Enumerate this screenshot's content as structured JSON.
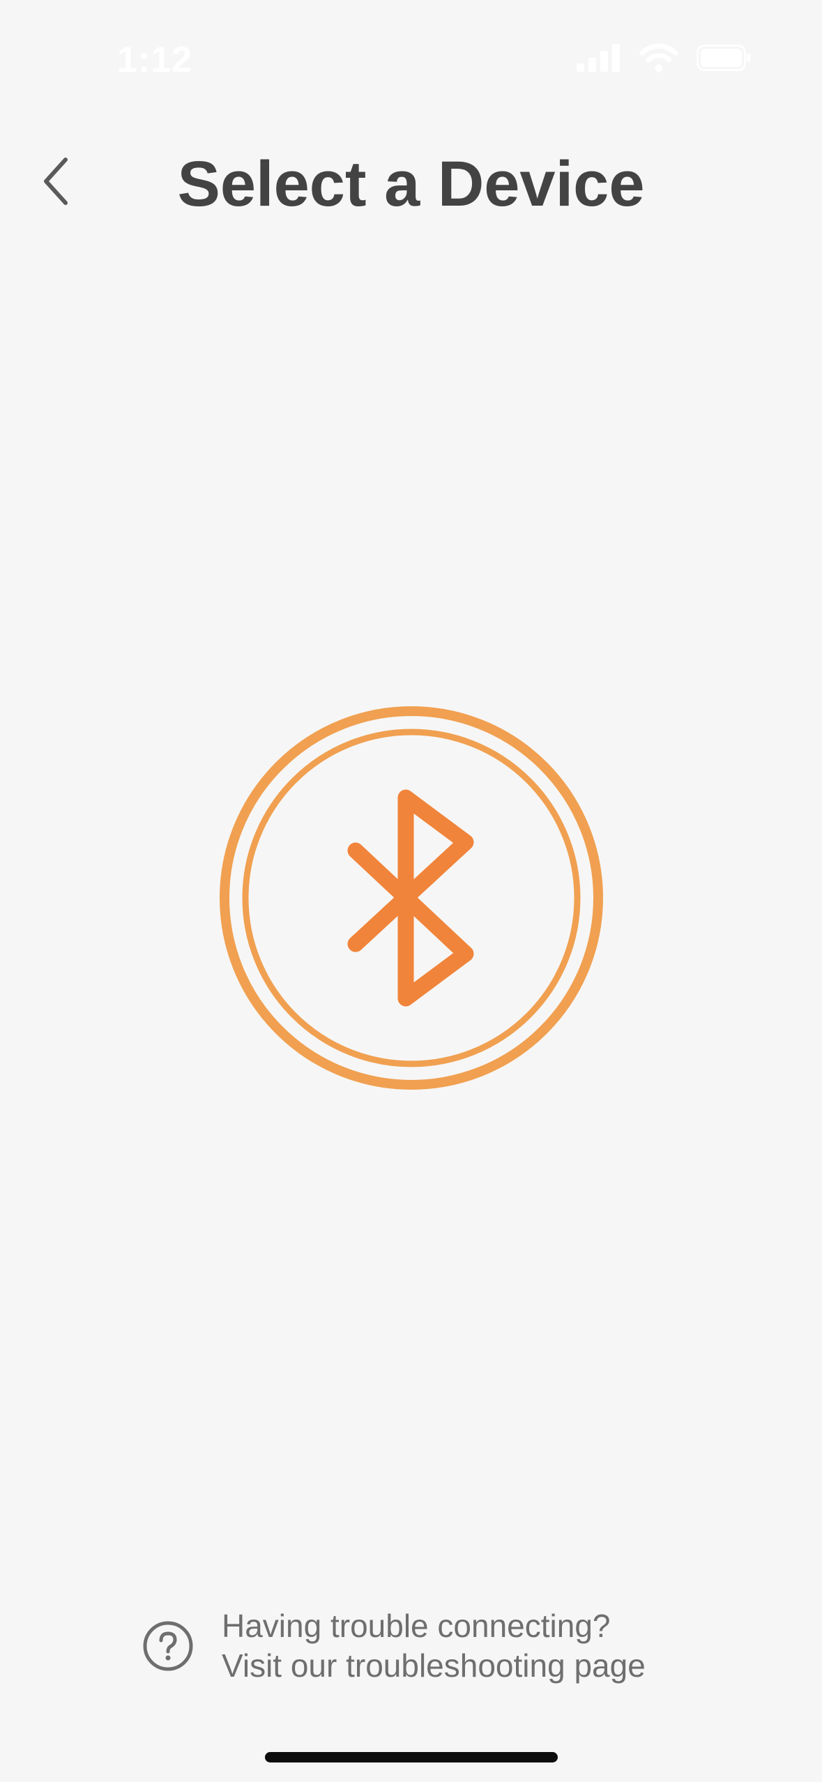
{
  "status_bar": {
    "time": "1:12",
    "icons": [
      "cellular-signal-icon",
      "wifi-icon",
      "battery-icon"
    ]
  },
  "header": {
    "title": "Select a Device",
    "back_icon": "chevron-left-icon"
  },
  "main": {
    "graphic_icon": "bluetooth-icon",
    "accent_color": "#f0843a",
    "ring_color": "#f0a050"
  },
  "help": {
    "icon": "question-circle-icon",
    "line1": "Having trouble connecting?",
    "line2": "Visit our troubleshooting page"
  }
}
